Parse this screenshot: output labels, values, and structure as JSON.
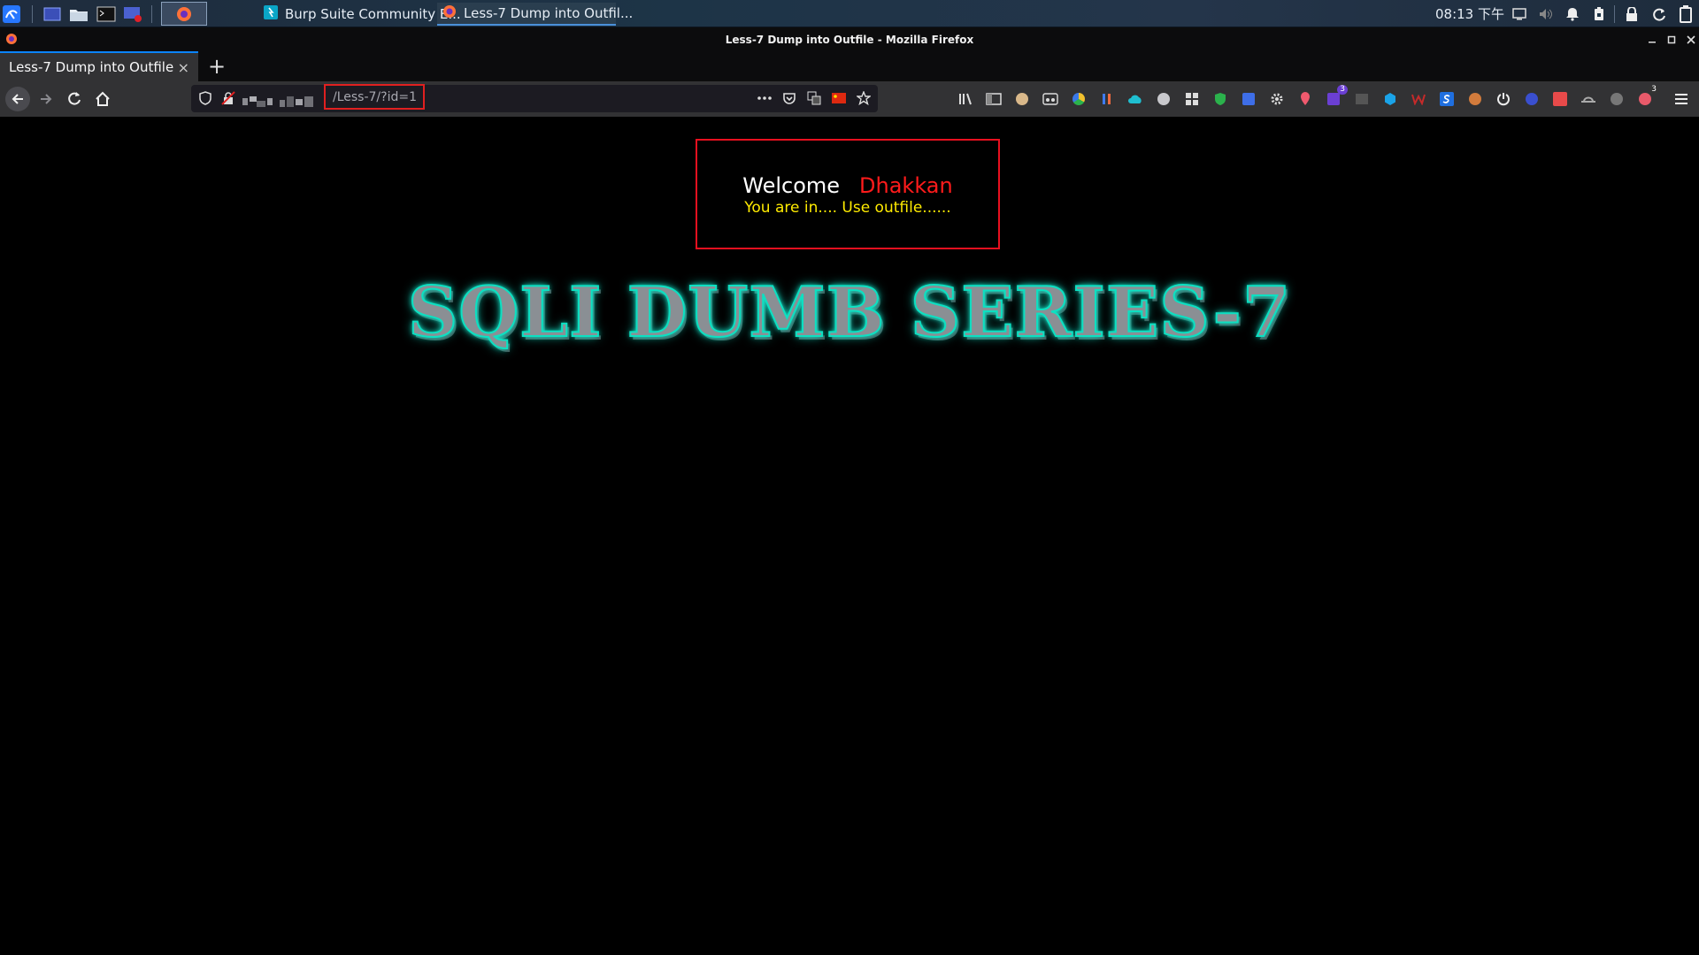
{
  "taskbar": {
    "tasks": [
      {
        "label": "Burp Suite Community E..."
      },
      {
        "label": "Less-7 Dump into Outfil..."
      }
    ],
    "clock": "08:13 下午"
  },
  "window": {
    "title": "Less-7 Dump into Outfile - Mozilla Firefox"
  },
  "tab": {
    "title": "Less-7 Dump into Outfile",
    "close": "×",
    "new_tab": "+"
  },
  "urlbar": {
    "path": "/Less-7/?id=1"
  },
  "extensions": {
    "badges": [
      "3",
      "3"
    ]
  },
  "page": {
    "welcome_word": "Welcome",
    "welcome_name": "Dhakkan",
    "message": "You are in.... Use outfile......",
    "banner": "SQLI DUMB SERIES-7"
  },
  "colors": {
    "welcome_text": "#ffffff",
    "name_text": "#ff1b1b",
    "message_text": "#ffeb00",
    "box_border": "#e8101f",
    "banner_glow": "#14f5d6",
    "url_highlight": "#e02020",
    "tab_accent": "#0a84ff"
  }
}
